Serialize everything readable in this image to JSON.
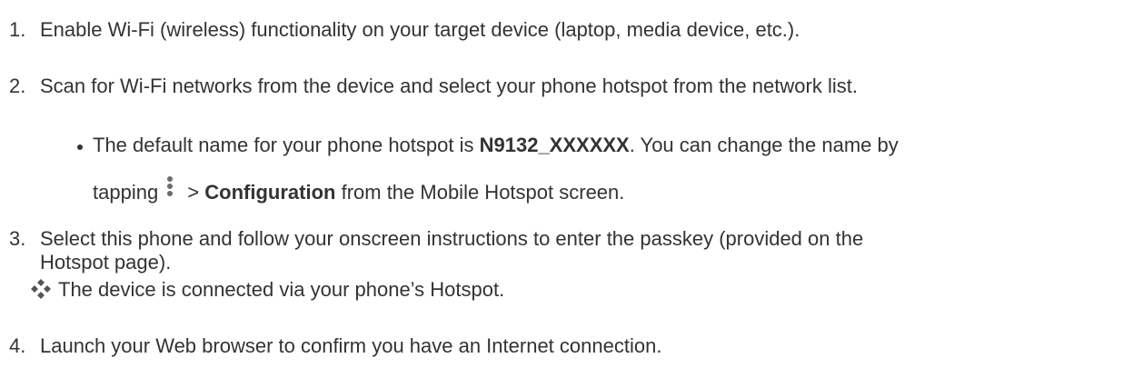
{
  "steps": [
    {
      "number": "1.",
      "text": "Enable Wi-Fi (wireless) functionality on your target device (laptop, media device, etc.)."
    },
    {
      "number": "2.",
      "text": "Scan for Wi-Fi networks from the device and select your phone hotspot from the network list."
    },
    {
      "number": "3.",
      "text_line1": "Select this phone and follow your onscreen instructions to enter the passkey (provided on the",
      "text_line2": "Hotspot page)."
    },
    {
      "number": "4.",
      "text": "Launch your Web browser to confirm you have an Internet connection."
    }
  ],
  "note": {
    "part1": "The default name for your phone hotspot is ",
    "hotspot_name": "N9132_XXXXXX",
    "part2": ". You can change the name by",
    "part3": "tapping",
    "separator": " > ",
    "menu_item": "Configuration",
    "part4": " from the Mobile Hotspot screen.",
    "icon": "more-vertical-icon"
  },
  "result": {
    "text": "The device is connected via your phone’s Hotspot.",
    "icon": "diamond-result-icon"
  }
}
